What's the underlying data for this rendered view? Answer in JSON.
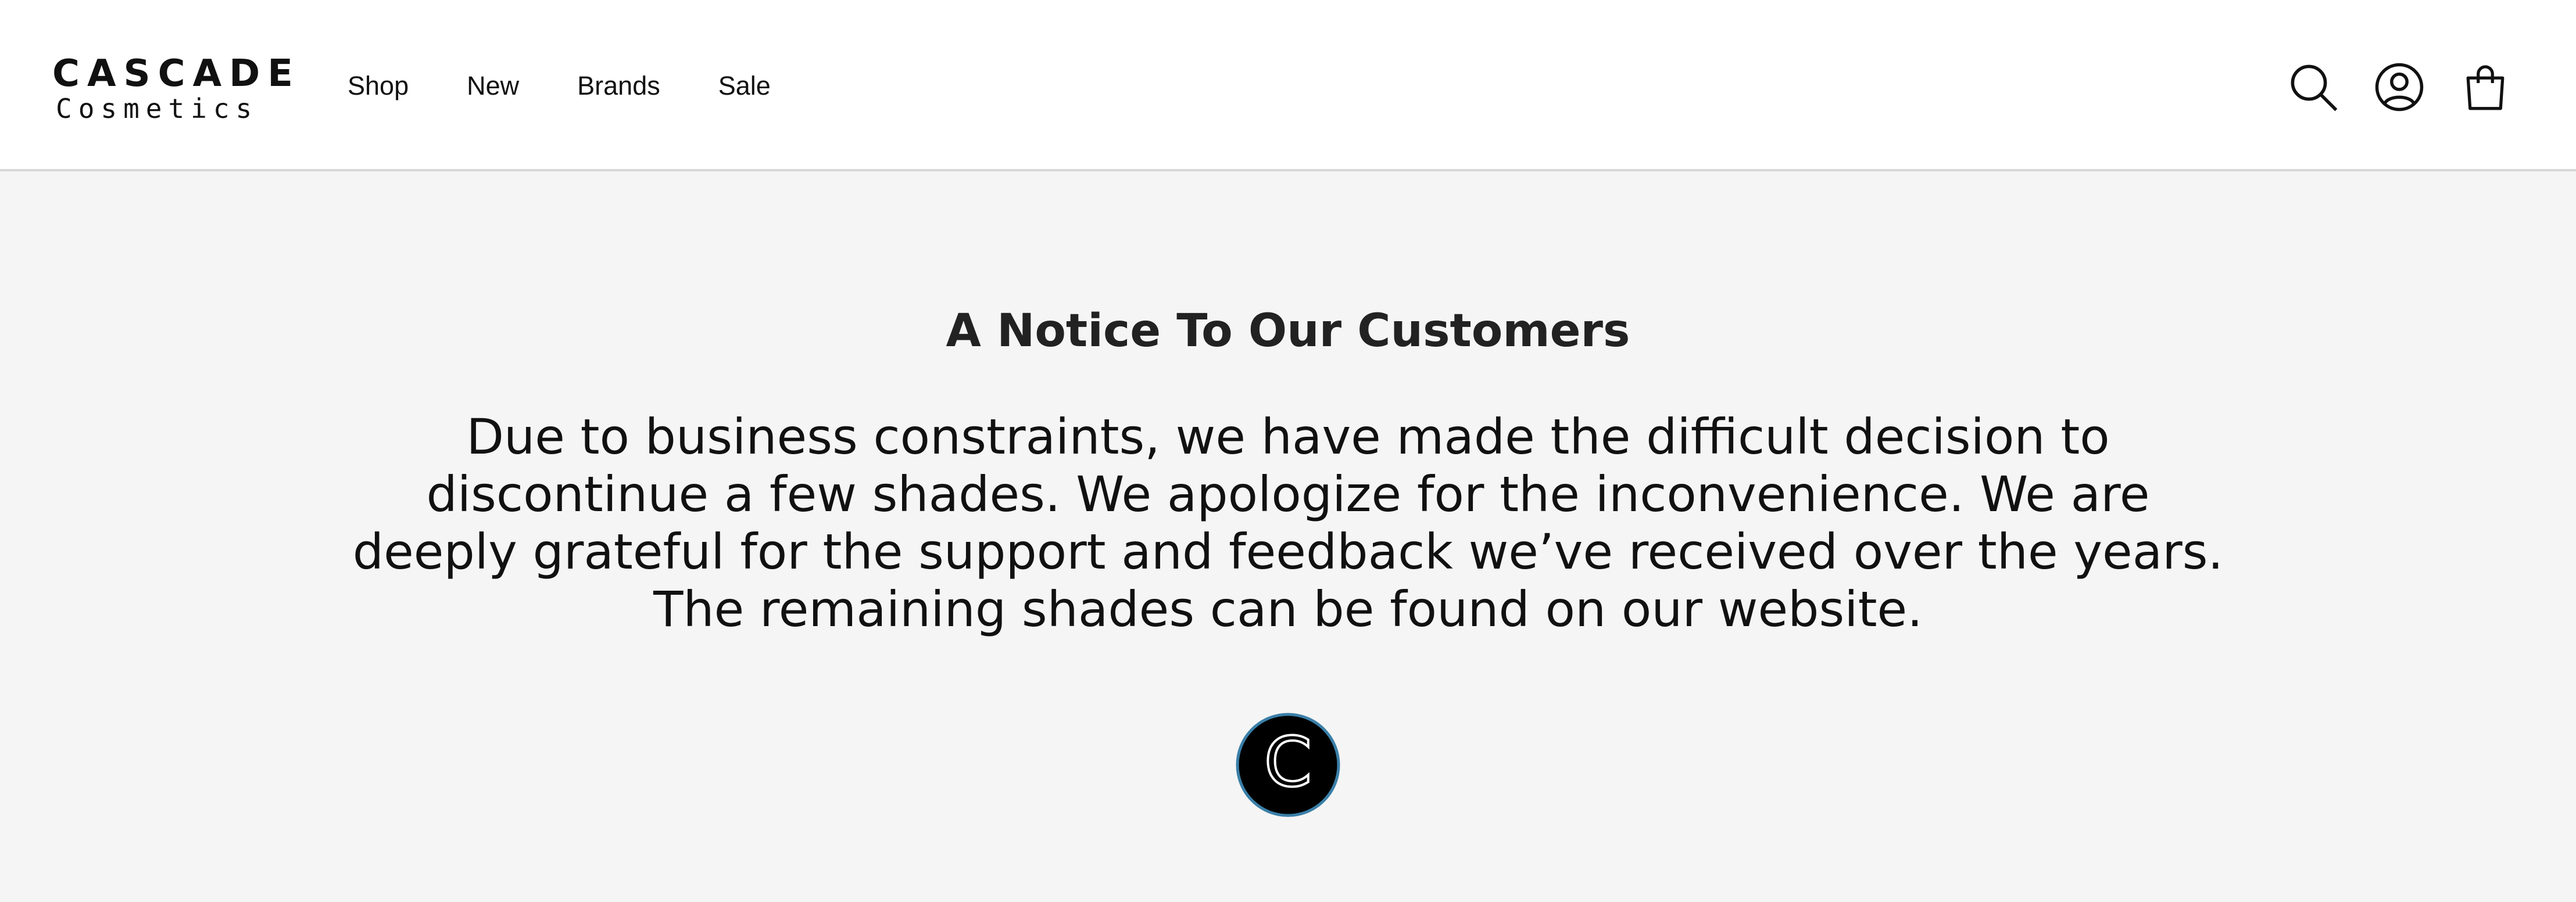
{
  "header": {
    "logo": {
      "line1": "CASCADE",
      "line2": "Cosmetics"
    },
    "nav": [
      {
        "label": "Shop"
      },
      {
        "label": "New"
      },
      {
        "label": "Brands"
      },
      {
        "label": "Sale"
      }
    ],
    "icons": [
      "search-icon",
      "account-icon",
      "cart-icon"
    ]
  },
  "notice": {
    "title": "A Notice To Our Customers",
    "body": "Due to business constraints, we have made the difficult decision to discontinue a few shades. We apologize for the inconvenience. We are deeply grateful for the support and feedback we’ve received over the years. The remaining shades can be found on our website.",
    "mark_letter": "C"
  },
  "colors": {
    "header_bg": "#ffffff",
    "page_bg": "#f5f5f5",
    "text": "#111111",
    "mark_ring": "#3a7fa8"
  }
}
